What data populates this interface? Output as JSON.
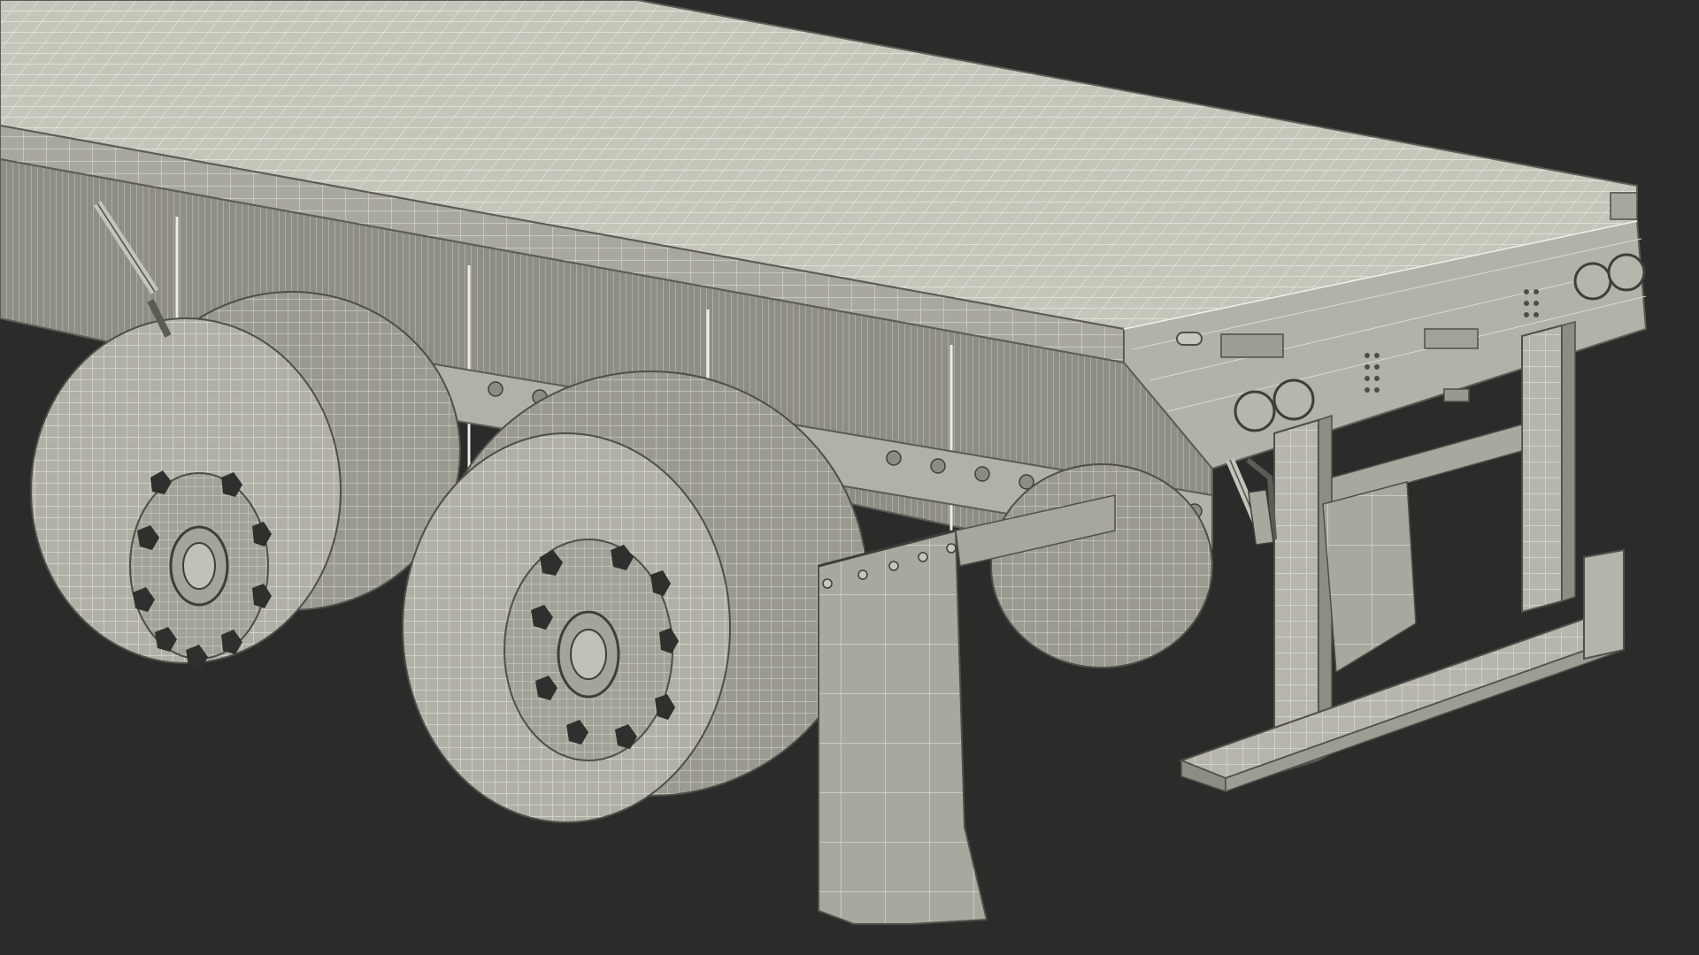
{
  "scene": {
    "subject": "flatbed-trailer-wireframe",
    "colors": {
      "background": "#2b2b2a",
      "surface_light": "#c4c3b8",
      "surface_mid": "#a8a79d",
      "surface_dark": "#8e8d84",
      "shadow": "#6f6e67",
      "tire": "#b3b2a8",
      "tire_dark": "#9a998f",
      "wire": "#f2f1ea",
      "edge": "#5c5b55"
    }
  }
}
